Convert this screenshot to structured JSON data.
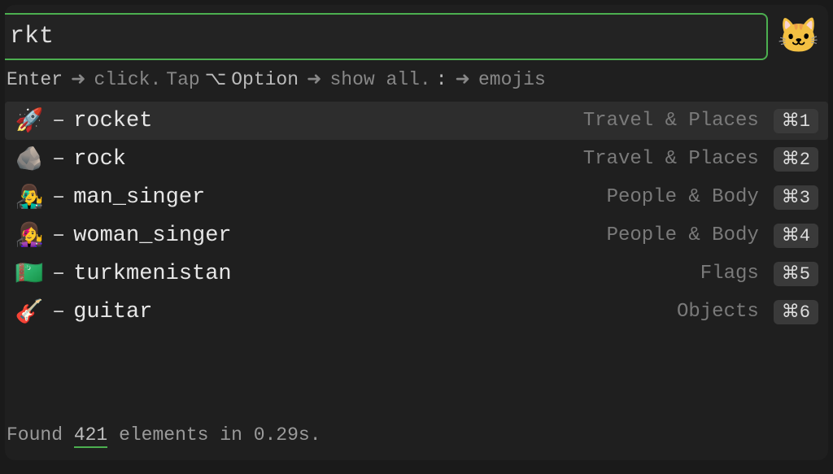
{
  "search": {
    "value": "rkt"
  },
  "avatar_glyph": "🐱",
  "hints": {
    "enter": "Enter",
    "click": "click.",
    "tap": "Tap",
    "option_sym": "⌥",
    "option_word": "Option",
    "show_all": "show all.",
    "colon": ":",
    "emojis": "emojis"
  },
  "results": [
    {
      "emoji": "🚀",
      "name": "rocket",
      "category": "Travel & Places",
      "shortcut": "⌘1",
      "selected": true
    },
    {
      "emoji": "🪨",
      "name": "rock",
      "category": "Travel & Places",
      "shortcut": "⌘2",
      "selected": false
    },
    {
      "emoji": "👨‍🎤",
      "name": "man_singer",
      "category": "People & Body",
      "shortcut": "⌘3",
      "selected": false
    },
    {
      "emoji": "👩‍🎤",
      "name": "woman_singer",
      "category": "People & Body",
      "shortcut": "⌘4",
      "selected": false
    },
    {
      "emoji": "🇹🇲",
      "name": "turkmenistan",
      "category": "Flags",
      "shortcut": "⌘5",
      "selected": false
    },
    {
      "emoji": "🎸",
      "name": "guitar",
      "category": "Objects",
      "shortcut": "⌘6",
      "selected": false
    }
  ],
  "status": {
    "prefix": "Found",
    "count": "421",
    "mid": "elements in",
    "time": "0.29s."
  }
}
